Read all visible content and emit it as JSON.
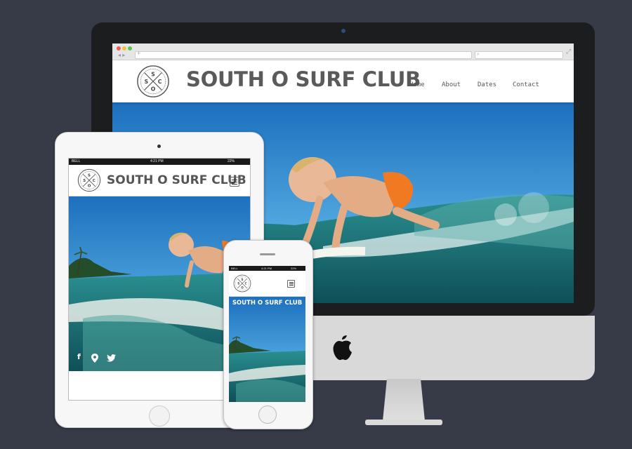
{
  "site": {
    "title": "SOUTH O SURF CLUB",
    "logo_letters": [
      "S",
      "S",
      "O",
      "C"
    ],
    "nav": [
      "Home",
      "About",
      "Dates",
      "Contact"
    ]
  },
  "status_bar": {
    "carrier": "BELL",
    "time": "4:21 PM",
    "battery": "22%"
  },
  "icons": {
    "social": [
      "facebook-icon",
      "map-pin-icon",
      "twitter-icon"
    ],
    "device": [
      "apple-logo-icon",
      "hamburger-menu-icon"
    ]
  },
  "colors": {
    "background": "#363b47",
    "title_text": "#5a5a5a",
    "sky": "#3f9ad6",
    "water": "#1f7f83"
  }
}
